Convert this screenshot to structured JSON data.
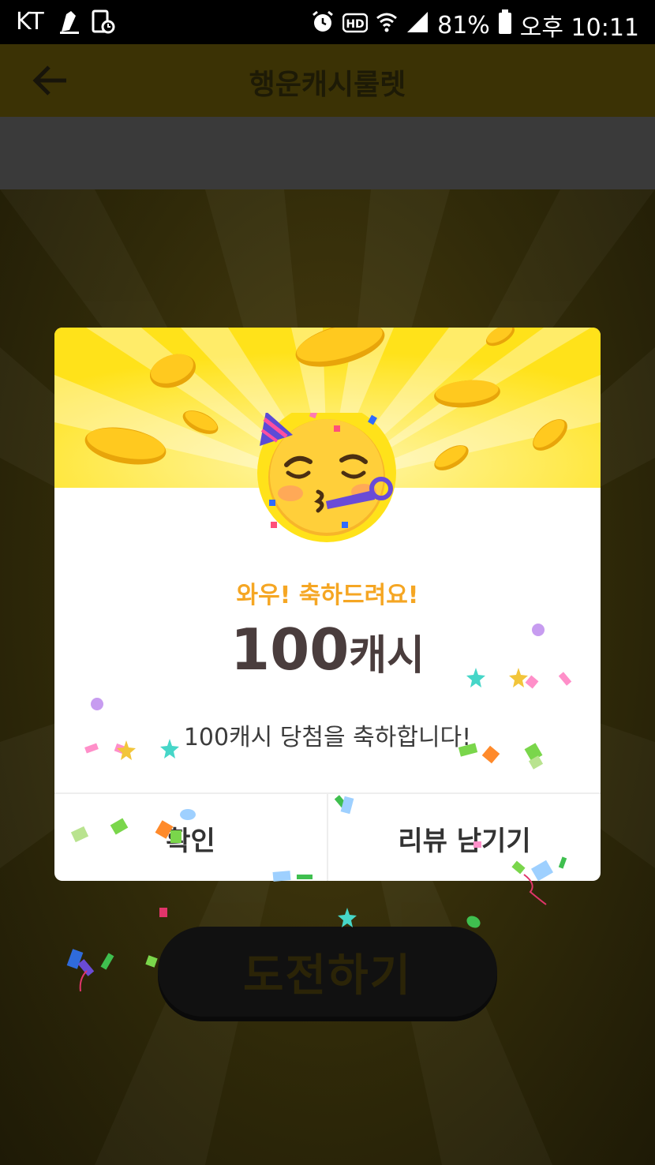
{
  "status_bar": {
    "carrier": "KT",
    "battery": "81%",
    "time": "오후 10:11",
    "icons": [
      "sneaker-icon",
      "screen-timer-icon",
      "alarm-icon",
      "hd-icon",
      "wifi-icon",
      "signal-icon",
      "battery-icon"
    ]
  },
  "header": {
    "title": "행운캐시룰렛",
    "back_icon": "arrow-left-icon"
  },
  "dialog": {
    "emoji": "partying-face-emoji",
    "congrats_text": "와우! 축하드려요!",
    "amount_number": "100",
    "amount_unit": "캐시",
    "message": "100캐시 당첨을 축하합니다!",
    "buttons": {
      "confirm": "확인",
      "review": "리뷰 남기기"
    }
  },
  "challenge_button": "도전하기",
  "colors": {
    "banner": "#ffe21a",
    "congrats": "#f5a623",
    "amount": "#4a3d3d"
  }
}
